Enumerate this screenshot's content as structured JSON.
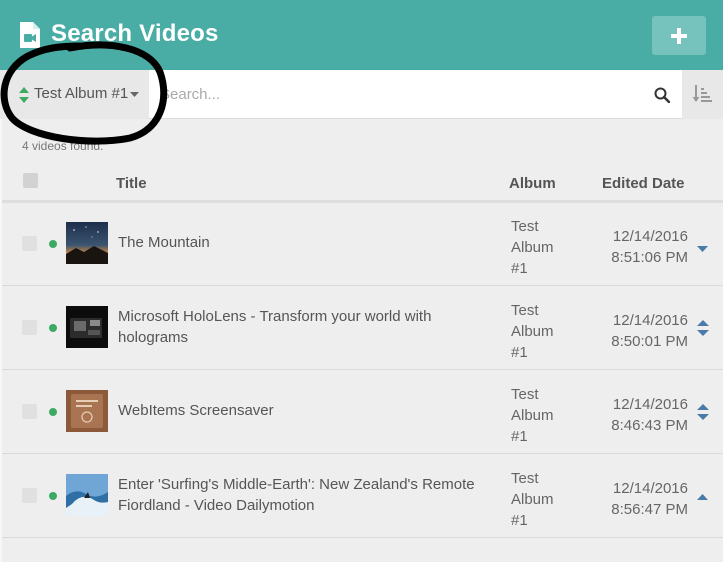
{
  "header": {
    "title": "Search Videos",
    "icon": "video-document-icon",
    "add_icon": "plus-icon"
  },
  "toolbar": {
    "album_selected": "Test Album #1",
    "search_placeholder": "Search...",
    "search_value": "",
    "search_icon": "magnifier-icon",
    "sort_icon": "sort-order-icon"
  },
  "results": {
    "count_text": "4 videos found."
  },
  "columns": {
    "title": "Title",
    "album": "Album",
    "edited": "Edited Date"
  },
  "rows": [
    {
      "title": "The Mountain",
      "album": [
        "Test",
        "Album",
        "#1"
      ],
      "date": "12/14/2016",
      "time": "8:51:06 PM",
      "status": "online",
      "arrow": "down"
    },
    {
      "title": "Microsoft HoloLens - Transform your world with holograms",
      "album": [
        "Test",
        "Album",
        "#1"
      ],
      "date": "12/14/2016",
      "time": "8:50:01 PM",
      "status": "online",
      "arrow": "both"
    },
    {
      "title": "WebItems Screensaver",
      "album": [
        "Test",
        "Album",
        "#1"
      ],
      "date": "12/14/2016",
      "time": "8:46:43 PM",
      "status": "online",
      "arrow": "both"
    },
    {
      "title": "Enter 'Surfing's Middle-Earth': New Zealand's Remote Fiordland - Video Dailymotion",
      "album": [
        "Test",
        "Album",
        "#1"
      ],
      "date": "12/14/2016",
      "time": "8:56:47 PM",
      "status": "online",
      "arrow": "up"
    }
  ],
  "colors": {
    "header": "#4aada5",
    "status_dot": "#3daa63",
    "arrow": "#4a7aa8"
  }
}
